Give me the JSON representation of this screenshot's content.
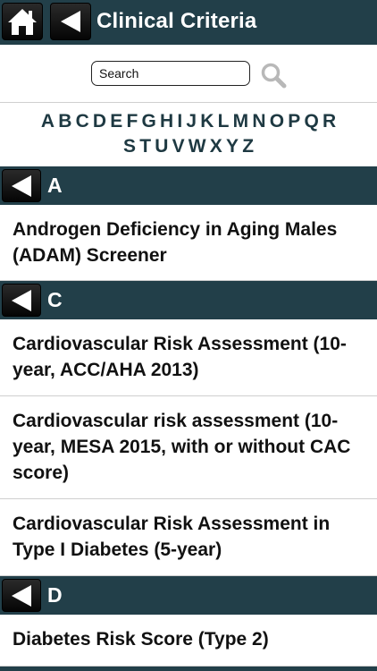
{
  "header": {
    "title": "Clinical Criteria"
  },
  "search": {
    "placeholder": "Search"
  },
  "alphabet": {
    "row1": [
      "A",
      "B",
      "C",
      "D",
      "E",
      "F",
      "G",
      "H",
      "I",
      "J",
      "K",
      "L",
      "M",
      "N",
      "O",
      "P",
      "Q",
      "R"
    ],
    "row2": [
      "S",
      "T",
      "U",
      "V",
      "W",
      "X",
      "Y",
      "Z"
    ]
  },
  "sections": [
    {
      "letter": "A",
      "items": [
        "Androgen Deficiency in Aging Males (ADAM) Screener"
      ]
    },
    {
      "letter": "C",
      "items": [
        "Cardiovascular Risk Assessment (10-year, ACC/AHA 2013)",
        "Cardiovascular risk assessment (10-year, MESA 2015, with or without CAC score)",
        "Cardiovascular Risk Assessment in Type I Diabetes (5-year)"
      ]
    },
    {
      "letter": "D",
      "items": [
        "Diabetes Risk Score (Type 2)"
      ]
    }
  ],
  "icons": {
    "home": "home-icon",
    "back": "back-arrow-icon",
    "search": "search-icon"
  },
  "colors": {
    "header_bg": "#223f49",
    "letter": "#1e3942"
  }
}
